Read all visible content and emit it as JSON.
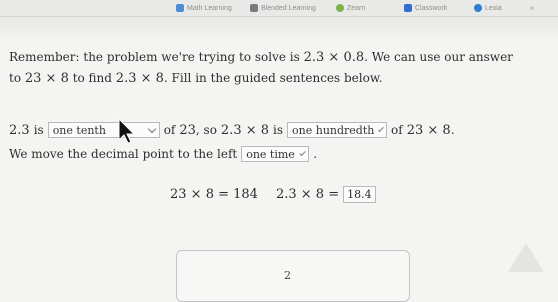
{
  "bookmarks": [
    {
      "label": "Math Learning",
      "color": "#4a8fd8"
    },
    {
      "label": "Blended Learning",
      "color": "#7b7b7b"
    },
    {
      "label": "Zearn",
      "color": "#7bb34a"
    },
    {
      "label": "Classwork",
      "color": "#2f6fd1"
    },
    {
      "label": "Lexia",
      "color": "#2c80c9"
    }
  ],
  "bookmarks_overflow": "»",
  "intro": {
    "sentence_1_start": "Remember: the problem we're trying to solve is",
    "sentence_1_expr": "2.3 × 0.8",
    "sentence_1_end": ". We can use our answer",
    "sentence_2_start": "to",
    "sentence_2_expr1": "23 × 8",
    "sentence_2_mid": "to find",
    "sentence_2_expr2": "2.3 × 8",
    "sentence_2_end": ". Fill in the guided sentences below."
  },
  "sentence1": {
    "lead": "2.3",
    "is_1": "is",
    "dropdown_1": "one tenth",
    "of_1": "of",
    "num_23": "23",
    "so": ", so",
    "expr": "2.3 × 8",
    "is_2": "is",
    "dropdown_2": "one hundredth",
    "of_2": "of",
    "expr2": "23 × 8",
    "end": "."
  },
  "sentence2": {
    "text": "We move the decimal point to the left",
    "dropdown_3": "one time",
    "end": "."
  },
  "equations": {
    "eq1": "23 × 8 = 184",
    "eq2_left": "2.3 × 8 =",
    "eq2_answer": "18.4"
  },
  "page_number": "2"
}
